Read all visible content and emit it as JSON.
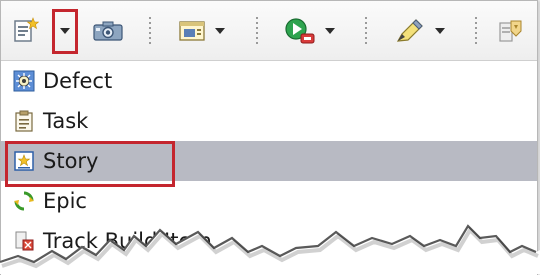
{
  "toolbar": {
    "buttons": [
      {
        "name": "new-work-item-icon"
      },
      {
        "name": "dropdown-arrow-icon"
      },
      {
        "name": "camera-icon"
      },
      {
        "name": "window-icon"
      },
      {
        "name": "run-icon"
      },
      {
        "name": "pencil-icon"
      },
      {
        "name": "build-icon"
      }
    ]
  },
  "menu": {
    "items": [
      {
        "label": "Defect",
        "icon": "defect-icon"
      },
      {
        "label": "Task",
        "icon": "task-icon"
      },
      {
        "label": "Story",
        "icon": "story-icon",
        "selected": true
      },
      {
        "label": "Epic",
        "icon": "epic-icon"
      },
      {
        "label": "Track Build Item",
        "icon": "track-build-item-icon"
      }
    ]
  },
  "colors": {
    "highlight_border": "#c4262e",
    "selected_row": "#b8bac3"
  }
}
